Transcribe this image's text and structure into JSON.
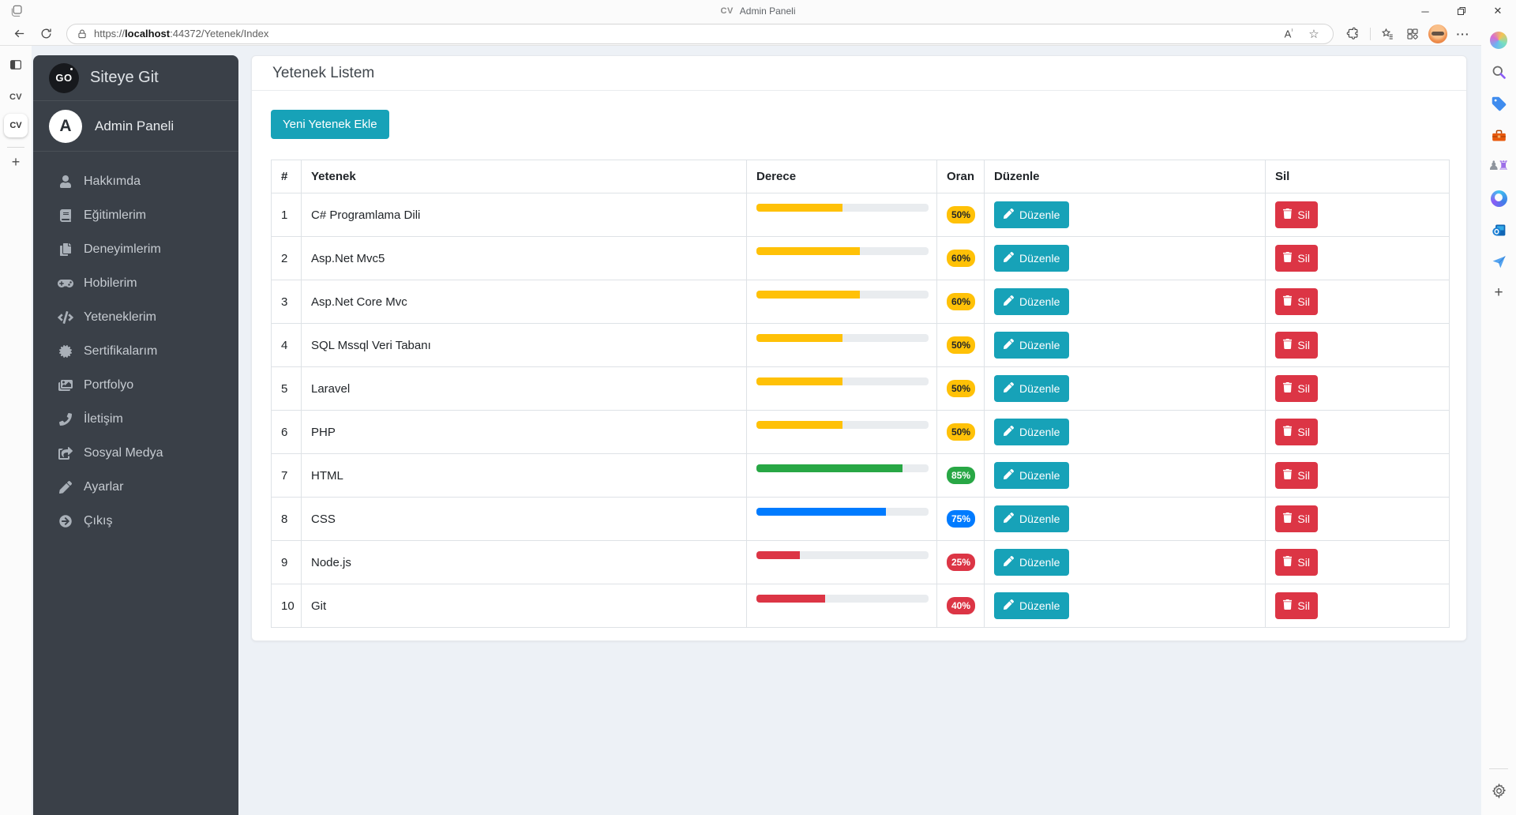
{
  "browser": {
    "tab_title": "Admin Paneli",
    "tab_favicon": "CV",
    "url": {
      "protocol": "https://",
      "host": "localhost",
      "path": ":44372/Yetenek/Index"
    },
    "left_rail": {
      "tabs": [
        "CV",
        "CV"
      ],
      "new_tab_label": "+"
    },
    "right_rail": {
      "icons": [
        "copilot",
        "search",
        "shopping",
        "toolbox",
        "games",
        "microsoft-365",
        "outlook",
        "drop",
        "add"
      ],
      "bottom_icons": [
        "settings"
      ]
    }
  },
  "sidebar": {
    "brand": {
      "logo": "GO",
      "label": "Siteye Git"
    },
    "profile": {
      "initial": "A",
      "label": "Admin Paneli"
    },
    "items": [
      {
        "icon": "user",
        "label": "Hakkımda"
      },
      {
        "icon": "book",
        "label": "Eğitimlerim"
      },
      {
        "icon": "copy",
        "label": "Deneyimlerim"
      },
      {
        "icon": "gamepad",
        "label": "Hobilerim"
      },
      {
        "icon": "code",
        "label": "Yeteneklerim"
      },
      {
        "icon": "certificate",
        "label": "Sertifikalarım"
      },
      {
        "icon": "images",
        "label": "Portfolyo"
      },
      {
        "icon": "phone",
        "label": "İletişim"
      },
      {
        "icon": "share",
        "label": "Sosyal Medya"
      },
      {
        "icon": "pencil",
        "label": "Ayarlar"
      },
      {
        "icon": "signout",
        "label": "Çıkış"
      }
    ]
  },
  "main": {
    "page_title": "Yetenek Listem",
    "add_button_label": "Yeni Yetenek Ekle",
    "table": {
      "headers": [
        "#",
        "Yetenek",
        "Derece",
        "Oran",
        "Düzenle",
        "Sil"
      ],
      "edit_label": "Düzenle",
      "delete_label": "Sil",
      "rows": [
        {
          "num": "1",
          "skill": "C# Programlama Dili",
          "percent": 50,
          "color": "warning"
        },
        {
          "num": "2",
          "skill": "Asp.Net Mvc5",
          "percent": 60,
          "color": "warning"
        },
        {
          "num": "3",
          "skill": "Asp.Net Core Mvc",
          "percent": 60,
          "color": "warning"
        },
        {
          "num": "4",
          "skill": "SQL Mssql Veri Tabanı",
          "percent": 50,
          "color": "warning"
        },
        {
          "num": "5",
          "skill": "Laravel",
          "percent": 50,
          "color": "warning"
        },
        {
          "num": "6",
          "skill": "PHP",
          "percent": 50,
          "color": "warning"
        },
        {
          "num": "7",
          "skill": "HTML",
          "percent": 85,
          "color": "success"
        },
        {
          "num": "8",
          "skill": "CSS",
          "percent": 75,
          "color": "primary"
        },
        {
          "num": "9",
          "skill": "Node.js",
          "percent": 25,
          "color": "danger"
        },
        {
          "num": "10",
          "skill": "Git",
          "percent": 40,
          "color": "danger"
        }
      ]
    }
  },
  "colors": {
    "warning": "#ffc107",
    "success": "#28a745",
    "primary": "#007bff",
    "danger": "#dc3545",
    "info": "#17a2b8"
  }
}
